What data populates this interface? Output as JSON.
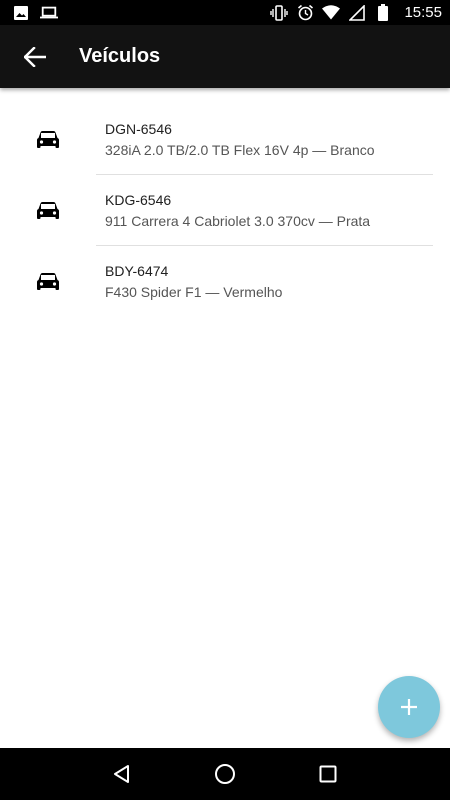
{
  "status_bar": {
    "time": "15:55",
    "left_icons": [
      "image-icon",
      "laptop-icon"
    ],
    "right_icons": [
      "vibrate-icon",
      "alarm-icon",
      "wifi-icon",
      "signal-icon",
      "battery-icon"
    ]
  },
  "app_bar": {
    "title": "Veículos",
    "back_icon": "arrow-back-icon"
  },
  "vehicles": [
    {
      "plate": "DGN-6546",
      "description": "328iA 2.0 TB/2.0 TB Flex 16V 4p — Branco",
      "icon": "car-icon"
    },
    {
      "plate": "KDG-6546",
      "description": "911 Carrera 4 Cabriolet 3.0 370cv — Prata",
      "icon": "car-icon"
    },
    {
      "plate": "BDY-6474",
      "description": "F430 Spider F1 — Vermelho",
      "icon": "car-icon"
    }
  ],
  "fab": {
    "icon": "plus-icon",
    "color": "#7ec8dc"
  },
  "nav_bar": {
    "buttons": [
      "back-triangle-icon",
      "home-circle-icon",
      "recents-square-icon"
    ]
  },
  "colors": {
    "app_bar": "#121212",
    "status_bar": "#000000",
    "accent": "#7ec8dc"
  }
}
